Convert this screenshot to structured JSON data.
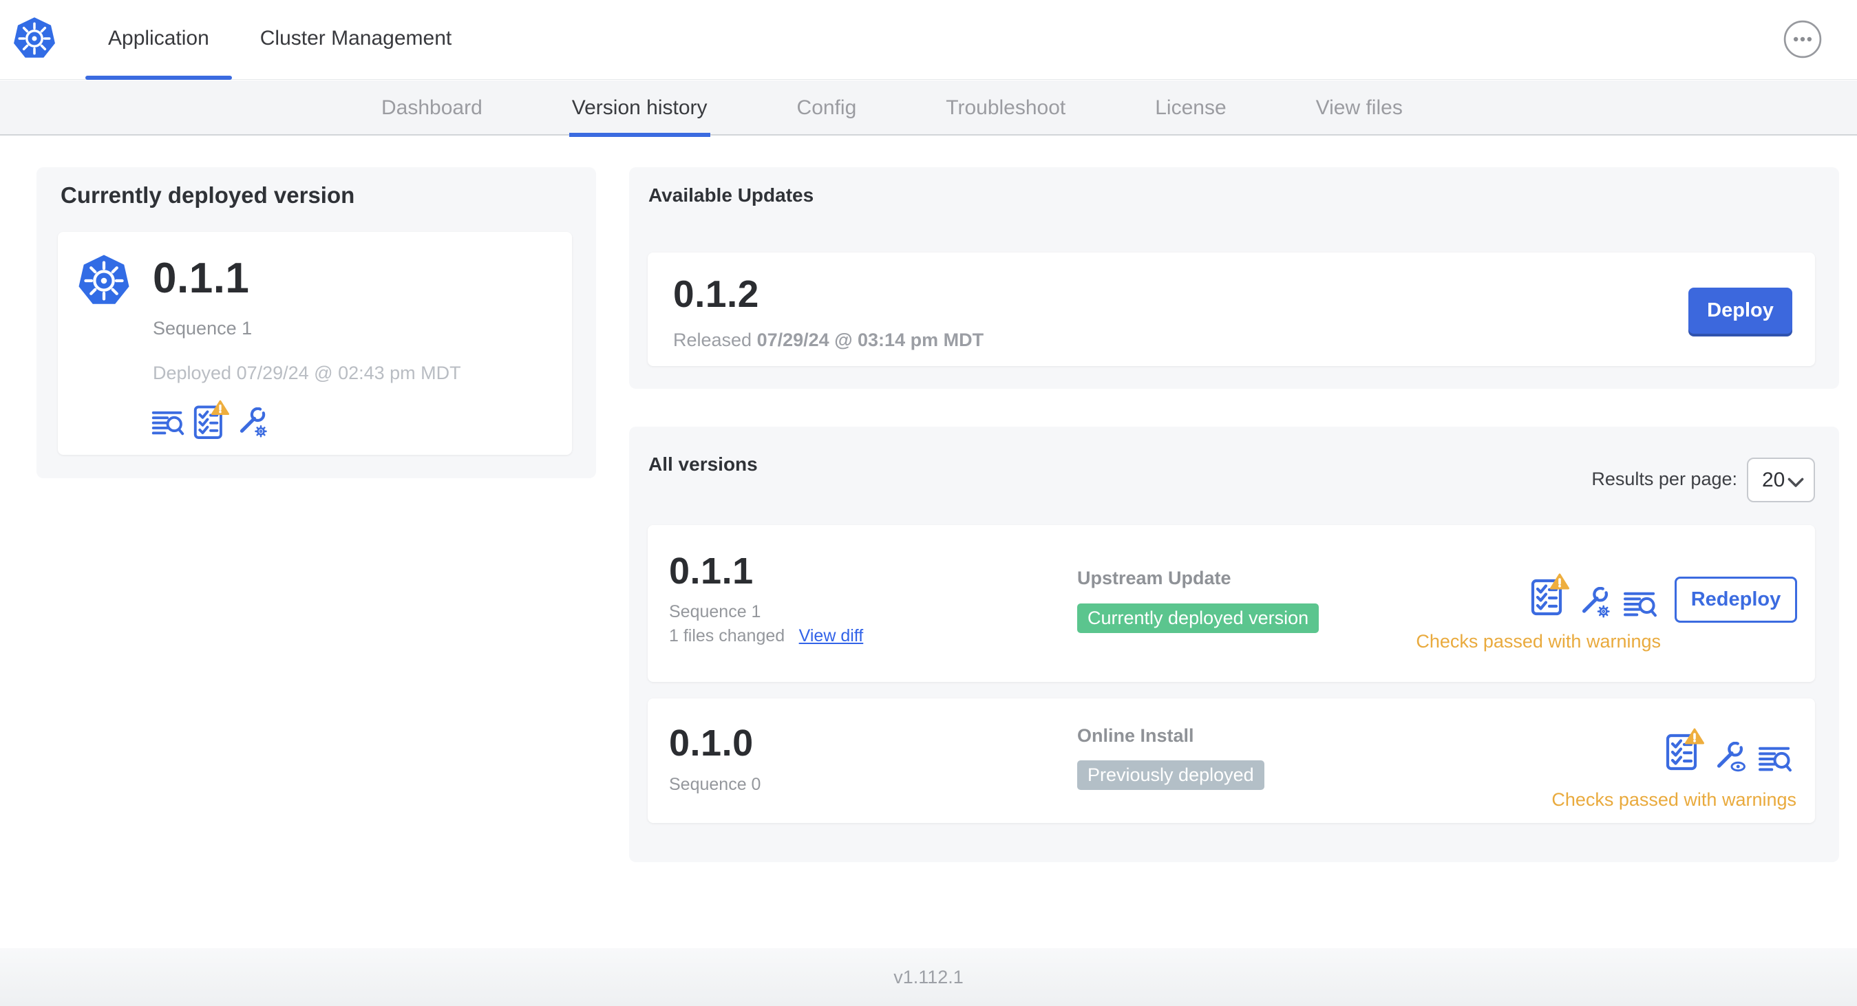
{
  "topbar": {
    "app_tabs": [
      {
        "label": "Application",
        "active": true
      },
      {
        "label": "Cluster Management",
        "active": false
      }
    ],
    "menu_icon": "ellipsis-circle"
  },
  "subnav": {
    "tabs": [
      "Dashboard",
      "Version history",
      "Config",
      "Troubleshoot",
      "License",
      "View files"
    ],
    "active_tab": "Version history"
  },
  "current_version": {
    "title": "Currently deployed version",
    "version": "0.1.1",
    "sequence": "Sequence 1",
    "deployed": "Deployed 07/29/24 @ 02:43 pm MDT",
    "icons": [
      "view-logs",
      "preflight-checks-warning",
      "edit-config"
    ]
  },
  "available_updates": {
    "title": "Available Updates",
    "version": "0.1.2",
    "released_prefix": "Released",
    "released_date": "07/29/24 @ 03:14 pm MDT",
    "deploy_button": "Deploy"
  },
  "all_versions": {
    "title": "All versions",
    "results_per_page_label": "Results per page:",
    "results_per_page_value": "20",
    "rows": [
      {
        "version": "0.1.1",
        "sequence": "Sequence 1",
        "files_changed": "1 files changed",
        "diff_link": "View diff",
        "source": "Upstream Update",
        "badge": "Currently deployed version",
        "badge_color": "#5bc58e",
        "status": "Checks passed with warnings",
        "action_button": "Redeploy",
        "icons": [
          "preflight-checks-warning",
          "edit-config",
          "view-logs"
        ]
      },
      {
        "version": "0.1.0",
        "sequence": "Sequence 0",
        "source": "Online Install",
        "badge": "Previously deployed",
        "badge_color": "#b3bfc7",
        "status": "Checks passed with warnings",
        "icons": [
          "preflight-checks-warning",
          "view-config",
          "view-logs"
        ]
      }
    ]
  },
  "footer": {
    "version_label": "v1.112.1"
  },
  "colors": {
    "accent_blue": "#3b6be0",
    "k8s_blue": "#326ce5",
    "green_badge": "#5bc58e",
    "gray_badge": "#b3bfc7",
    "warning_amber": "#e9aa3d",
    "link_blue": "#3263e8",
    "subnav_bg": "#f4f5f7",
    "card_bg": "#f6f7f9"
  }
}
